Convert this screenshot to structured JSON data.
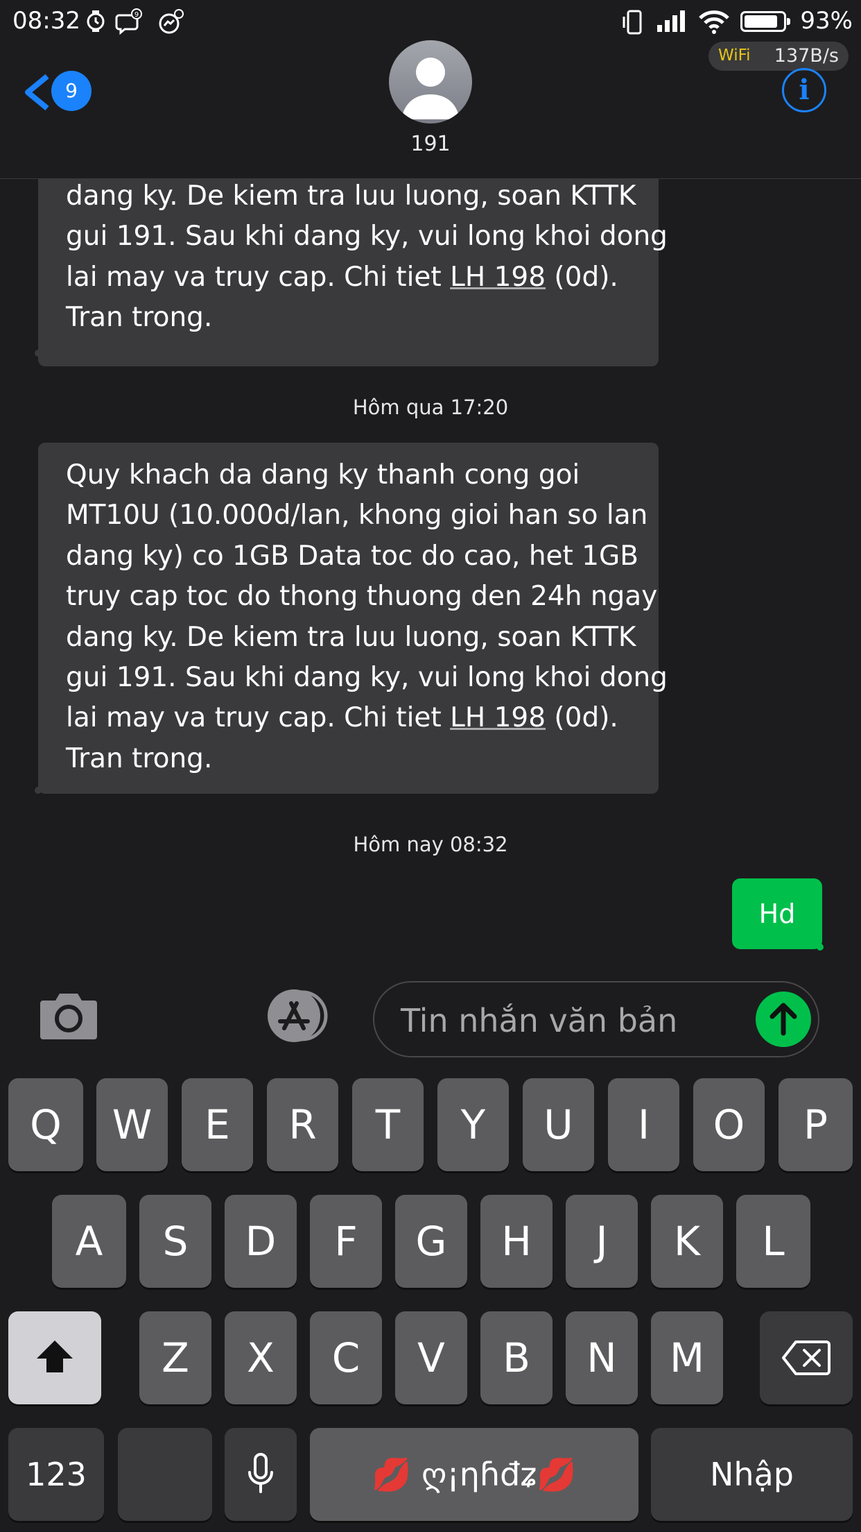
{
  "status_bar": {
    "time": "08:32",
    "battery_percent": "93%",
    "battery_level": 0.93,
    "net_label": "WiFi",
    "net_speed": "137B/s",
    "notification_badge": "9"
  },
  "header": {
    "back_badge": "9",
    "contact_name": "191",
    "info_glyph": "i"
  },
  "messages": {
    "incoming_1": {
      "lines": [
        "dang ky. De kiem tra luu luong, soan KTTK",
        "gui 191. Sau khi dang ky, vui long khoi dong",
        "lai may va truy cap. Chi tiet ",
        "LH 198",
        " (0d).",
        "Tran trong."
      ]
    },
    "timestamp_1": "Hôm qua 17:20",
    "incoming_2": {
      "lines": [
        "Quy khach da dang ky thanh cong goi",
        "MT10U (10.000d/lan, khong gioi han so lan",
        "dang ky) co 1GB Data toc do cao, het 1GB",
        "truy cap toc do thong thuong den 24h ngay",
        "dang ky. De kiem tra luu luong, soan KTTK",
        "gui 191. Sau khi dang ky, vui long khoi dong",
        "lai may va truy cap. Chi tiet ",
        "LH 198",
        " (0d).",
        "Tran trong."
      ]
    },
    "timestamp_2": "Hôm nay 08:32",
    "outgoing_1": "Hd"
  },
  "input": {
    "placeholder": "Tin nhắn văn bản"
  },
  "keyboard": {
    "row1": [
      "Q",
      "W",
      "E",
      "R",
      "T",
      "Y",
      "U",
      "I",
      "O",
      "P"
    ],
    "row2": [
      "A",
      "S",
      "D",
      "F",
      "G",
      "H",
      "J",
      "K",
      "L"
    ],
    "row3": [
      "Z",
      "X",
      "C",
      "V",
      "B",
      "N",
      "M"
    ],
    "numbers_key": "123",
    "space_label": "💋 ღ¡ηɦđʑ💋",
    "return_key": "Nhập"
  },
  "colors": {
    "accent_blue": "#1a82fb",
    "sent_green": "#00c04b",
    "bubble_gray": "#3a3a3c",
    "background": "#1c1c1e"
  },
  "icons": [
    "alarm-icon",
    "chat-icon",
    "messenger-icon",
    "phone-vibrate-icon",
    "signal-icon",
    "wifi-icon",
    "battery-icon",
    "back-chevron-icon",
    "avatar-icon",
    "info-icon",
    "camera-icon",
    "app-store-icon",
    "send-arrow-icon",
    "shift-icon",
    "backspace-icon",
    "microphone-icon"
  ]
}
